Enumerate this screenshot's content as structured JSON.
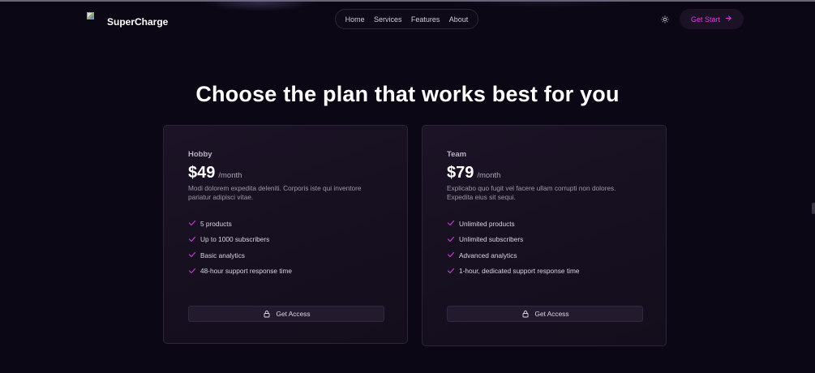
{
  "brand": {
    "name": "SuperCharge",
    "logo_icon": "broken-image-icon"
  },
  "nav": {
    "items": [
      {
        "label": "Home"
      },
      {
        "label": "Services"
      },
      {
        "label": "Features"
      },
      {
        "label": "About"
      }
    ],
    "theme_icon": "sun-icon",
    "cta_label": "Get Start",
    "cta_icon": "arrow-right-icon"
  },
  "headline": "Choose the plan that works best for you",
  "plans": [
    {
      "name": "Hobby",
      "price": "$49",
      "period": "/month",
      "description": "Modi dolorem expedita deleniti. Corporis iste qui inventore pariatur adipisci vitae.",
      "features": [
        "5 products",
        "Up to 1000 subscribers",
        "Basic analytics",
        "48-hour support response time"
      ],
      "button_label": "Get Access"
    },
    {
      "name": "Team",
      "price": "$79",
      "period": "/month",
      "description": "Explicabo quo fugit vel facere ullam corrupti non dolores. Expedita eius sit sequi.",
      "features": [
        "Unlimited products",
        "Unlimited subscribers",
        "Advanced analytics",
        "1-hour, dedicated support response time"
      ],
      "button_label": "Get Access"
    }
  ],
  "colors": {
    "background": "#0c0714",
    "accent": "#d53dd8",
    "card": "#1a1224"
  }
}
